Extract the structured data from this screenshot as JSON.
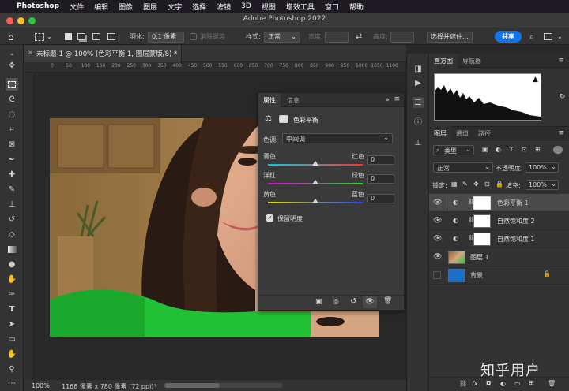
{
  "menubar": {
    "app": "Photoshop",
    "items": [
      "文件",
      "编辑",
      "图像",
      "图层",
      "文字",
      "选择",
      "滤镜",
      "3D",
      "视图",
      "增效工具",
      "窗口",
      "帮助"
    ]
  },
  "window": {
    "title": "Adobe Photoshop 2022"
  },
  "options": {
    "feather_label": "羽化:",
    "feather_value": "0.1 像素",
    "antialias_label": "消除锯齿",
    "style_label": "样式:",
    "style_value": "正常",
    "width_label": "宽度:",
    "height_label": "高度:",
    "select_mask": "选择并遮住...",
    "share": "共享"
  },
  "document": {
    "tab_title": "未标题-1 @ 100% (色彩平衡 1, 图层蒙版/8) *",
    "zoom": "100%",
    "info": "1168 像素 x 780 像素 (72 ppi)"
  },
  "ruler_labels": [
    "0",
    "50",
    "100",
    "150",
    "200",
    "250",
    "300",
    "350",
    "400",
    "450",
    "500",
    "550",
    "600",
    "650",
    "700",
    "750",
    "800",
    "850",
    "900",
    "950",
    "1000",
    "1050",
    "1100"
  ],
  "properties": {
    "tabs": [
      "属性",
      "信息"
    ],
    "adjustment": "色彩平衡",
    "tone_label": "色调:",
    "tone_value": "中间调",
    "sliders": [
      {
        "left": "青色",
        "right": "红色",
        "value": "0"
      },
      {
        "left": "洋红",
        "right": "绿色",
        "value": "0"
      },
      {
        "left": "黄色",
        "right": "蓝色",
        "value": "0"
      }
    ],
    "preserve_label": "保留明度"
  },
  "histogram": {
    "tabs": [
      "直方图",
      "导航器"
    ]
  },
  "layers": {
    "tabs": [
      "图层",
      "通道",
      "路径"
    ],
    "filter": "类型",
    "blend_mode": "正常",
    "opacity_label": "不透明度:",
    "opacity_value": "100%",
    "lock_label": "锁定:",
    "fill_label": "填充:",
    "fill_value": "100%",
    "rows": [
      {
        "name": "色彩平衡 1"
      },
      {
        "name": "自然饱和度 2"
      },
      {
        "name": "自然饱和度 1"
      },
      {
        "name": "图层 1"
      },
      {
        "name": "背景"
      }
    ],
    "bottom_fx": "fx"
  },
  "watermark": "知乎用户",
  "colors": {
    "accent": "#1473e6",
    "background_layer": "#1e6fc8"
  }
}
